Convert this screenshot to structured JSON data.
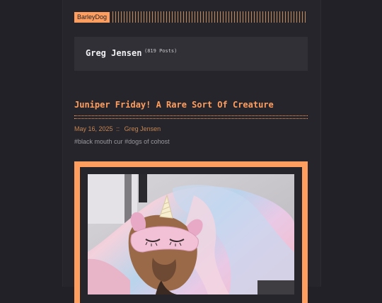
{
  "site": {
    "name": "BarleyDog"
  },
  "author_card": {
    "name": "Greg Jensen",
    "post_count": "(819 Posts)"
  },
  "post": {
    "title": "Juniper Friday! A Rare Sort Of Creature",
    "date": "May 16, 2025",
    "separator": "::",
    "author": "Greg Jensen",
    "tags": [
      "#black mouth cur",
      "#dogs of cohost"
    ]
  },
  "image": {
    "description_icon": "dog-photo"
  },
  "colors": {
    "accent": "#ff9e5e",
    "background": "#222127",
    "card": "#303036",
    "meta": "#c58551"
  }
}
